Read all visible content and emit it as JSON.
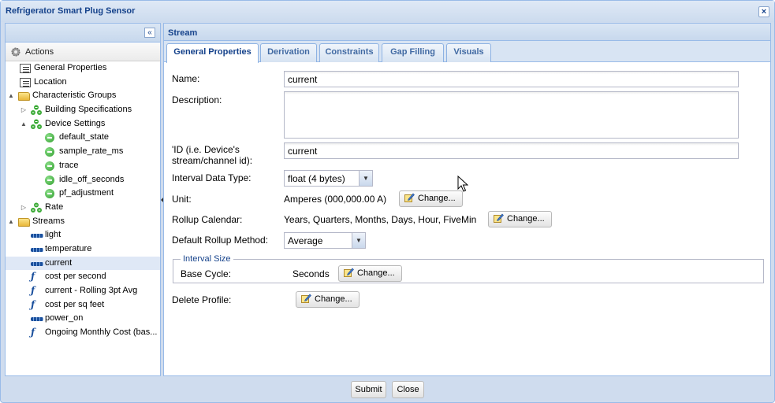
{
  "window": {
    "title": "Refrigerator Smart Plug Sensor",
    "close_glyph": "×"
  },
  "left_panel": {
    "collapse_glyph": "«",
    "actions_label": "Actions",
    "tree": [
      {
        "label": "General Properties",
        "icon": "properties-icon",
        "level": 1,
        "arrow": ""
      },
      {
        "label": "Location",
        "icon": "properties-icon",
        "level": 1,
        "arrow": ""
      },
      {
        "label": "Characteristic Groups",
        "icon": "folder-icon",
        "level": 0,
        "arrow": "▲"
      },
      {
        "label": "Building Specifications",
        "icon": "group-icon",
        "level": 1,
        "arrow": "▷"
      },
      {
        "label": "Device Settings",
        "icon": "group-icon",
        "level": 1,
        "arrow": "▲"
      },
      {
        "label": "default_state",
        "icon": "setting-icon",
        "level": 2,
        "arrow": ""
      },
      {
        "label": "sample_rate_ms",
        "icon": "setting-icon",
        "level": 2,
        "arrow": ""
      },
      {
        "label": "trace",
        "icon": "setting-icon",
        "level": 2,
        "arrow": ""
      },
      {
        "label": "idle_off_seconds",
        "icon": "setting-icon",
        "level": 2,
        "arrow": ""
      },
      {
        "label": "pf_adjustment",
        "icon": "setting-icon",
        "level": 2,
        "arrow": ""
      },
      {
        "label": "Rate",
        "icon": "group-icon",
        "level": 1,
        "arrow": "▷"
      },
      {
        "label": "Streams",
        "icon": "folder-icon",
        "level": 0,
        "arrow": "▲"
      },
      {
        "label": "light",
        "icon": "stream-icon",
        "level": 1,
        "arrow": ""
      },
      {
        "label": "temperature",
        "icon": "stream-icon",
        "level": 1,
        "arrow": ""
      },
      {
        "label": "current",
        "icon": "stream-icon",
        "level": 1,
        "arrow": "",
        "selected": true
      },
      {
        "label": "cost per second",
        "icon": "function-icon",
        "level": 1,
        "arrow": ""
      },
      {
        "label": "current - Rolling 3pt Avg",
        "icon": "function-icon",
        "level": 1,
        "arrow": ""
      },
      {
        "label": "cost per sq feet",
        "icon": "function-icon",
        "level": 1,
        "arrow": ""
      },
      {
        "label": "power_on",
        "icon": "stream-icon",
        "level": 1,
        "arrow": ""
      },
      {
        "label": "Ongoing Monthly Cost (bas...",
        "icon": "function-icon",
        "level": 1,
        "arrow": ""
      }
    ]
  },
  "stream_panel": {
    "header": "Stream",
    "tabs": [
      "General Properties",
      "Derivation",
      "Constraints",
      "Gap Filling",
      "Visuals"
    ],
    "active_tab": "General Properties",
    "form": {
      "name_label": "Name:",
      "name_value": "current",
      "description_label": "Description:",
      "description_value": "",
      "id_label_1": "'ID (i.e. Device's",
      "id_label_2": "stream/channel id):",
      "id_value": "current",
      "interval_type_label": "Interval Data Type:",
      "interval_type_value": "float (4 bytes)",
      "unit_label": "Unit:",
      "unit_value": "Amperes (000,000.00 A)",
      "rollup_calendar_label": "Rollup Calendar:",
      "rollup_calendar_value": "Years, Quarters, Months, Days, Hour, FiveMin",
      "default_rollup_label": "Default Rollup Method:",
      "default_rollup_value": "Average",
      "interval_size_legend": "Interval Size",
      "base_cycle_label": "Base Cycle:",
      "base_cycle_value": "Seconds",
      "delete_profile_label": "Delete Profile:",
      "change_label": "Change..."
    }
  },
  "footer": {
    "submit_label": "Submit",
    "close_label": "Close"
  }
}
